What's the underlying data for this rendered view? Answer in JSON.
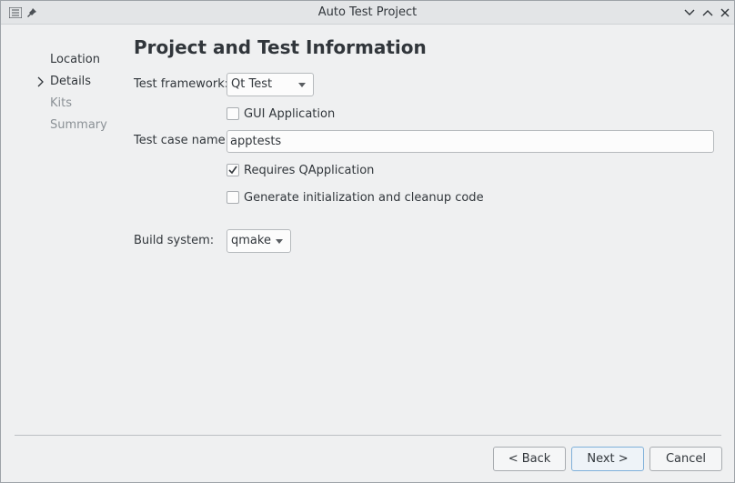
{
  "window": {
    "title": "Auto Test Project",
    "menu_icon": "window-menu-icon",
    "pin_icon": "pin-icon",
    "min_icon": "minimize-icon",
    "max_icon": "maximize-icon",
    "close_icon": "close-icon"
  },
  "steps": [
    {
      "label": "Location",
      "state": "done"
    },
    {
      "label": "Details",
      "state": "current"
    },
    {
      "label": "Kits",
      "state": "pending"
    },
    {
      "label": "Summary",
      "state": "pending"
    }
  ],
  "page": {
    "title": "Project and Test Information",
    "test_framework_label": "Test framework:",
    "test_framework_value": "Qt Test",
    "gui_app_label": "GUI Application",
    "gui_app_checked": false,
    "test_case_label": "Test case name:",
    "test_case_value": "apptests",
    "requires_qapp_label": "Requires QApplication",
    "requires_qapp_checked": true,
    "gen_init_label": "Generate initialization and cleanup code",
    "gen_init_checked": false,
    "build_system_label": "Build system:",
    "build_system_value": "qmake"
  },
  "buttons": {
    "back": "< Back",
    "next": "Next >",
    "cancel": "Cancel"
  },
  "colors": {
    "accent": "#3daee9",
    "inactive_text": "#8b9196"
  }
}
